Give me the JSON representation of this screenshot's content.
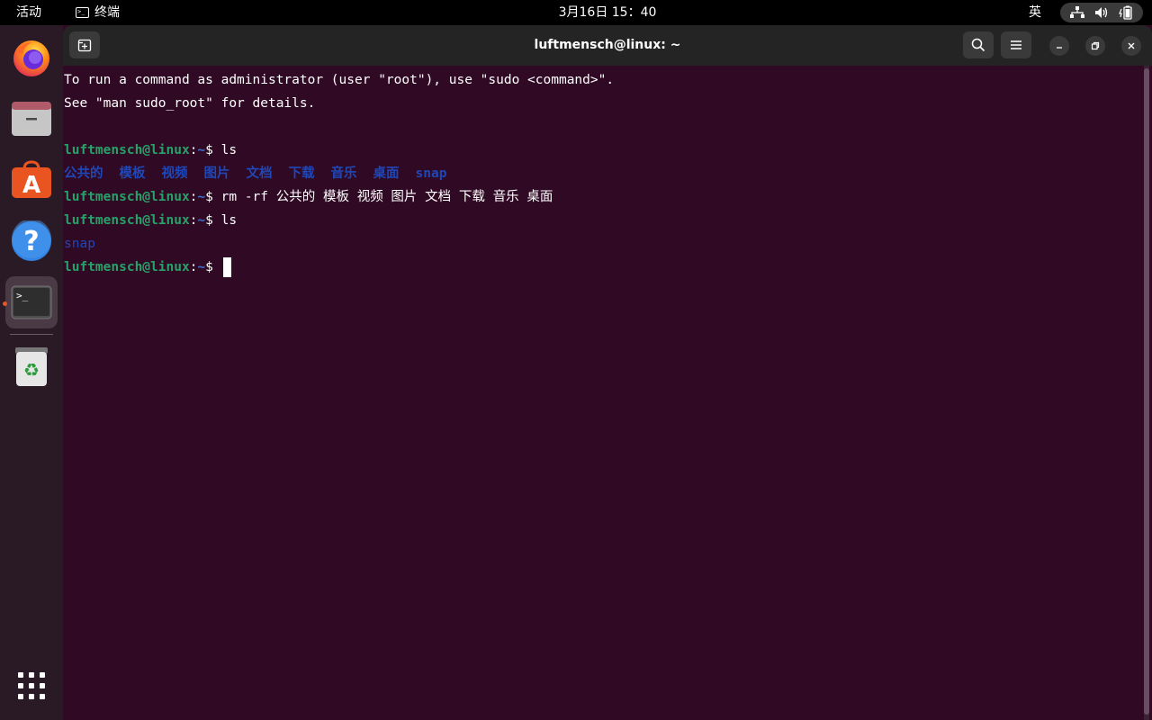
{
  "topbar": {
    "activities": "活动",
    "app_name": "终端",
    "clock": "3月16日  15：40",
    "input_method": "英"
  },
  "dock": {
    "items": [
      "firefox",
      "files",
      "ubuntu-software",
      "help",
      "terminal",
      "trash"
    ],
    "active": "terminal"
  },
  "window": {
    "title": "luftmensch@linux: ~"
  },
  "terminal": {
    "motd1": "To run a command as administrator (user \"root\"), use \"sudo <command>\".",
    "motd2": "See \"man sudo_root\" for details.",
    "user_host": "luftmensch@linux",
    "colon": ":",
    "path": "~",
    "prompt": "$ ",
    "cmd1": "ls",
    "dirs": [
      "公共的",
      "模板",
      "视频",
      "图片",
      "文档",
      "下载",
      "音乐",
      "桌面",
      "snap"
    ],
    "cmd2": "rm -rf 公共的 模板 视频 图片 文档 下载 音乐 桌面",
    "cmd3": "ls",
    "out3": "snap"
  },
  "colors": {
    "terminal_bg": "#300a24",
    "user_host": "#26a269",
    "path": "#3f6fd0",
    "directory": "#1f47b8",
    "accent": "#e95420"
  }
}
